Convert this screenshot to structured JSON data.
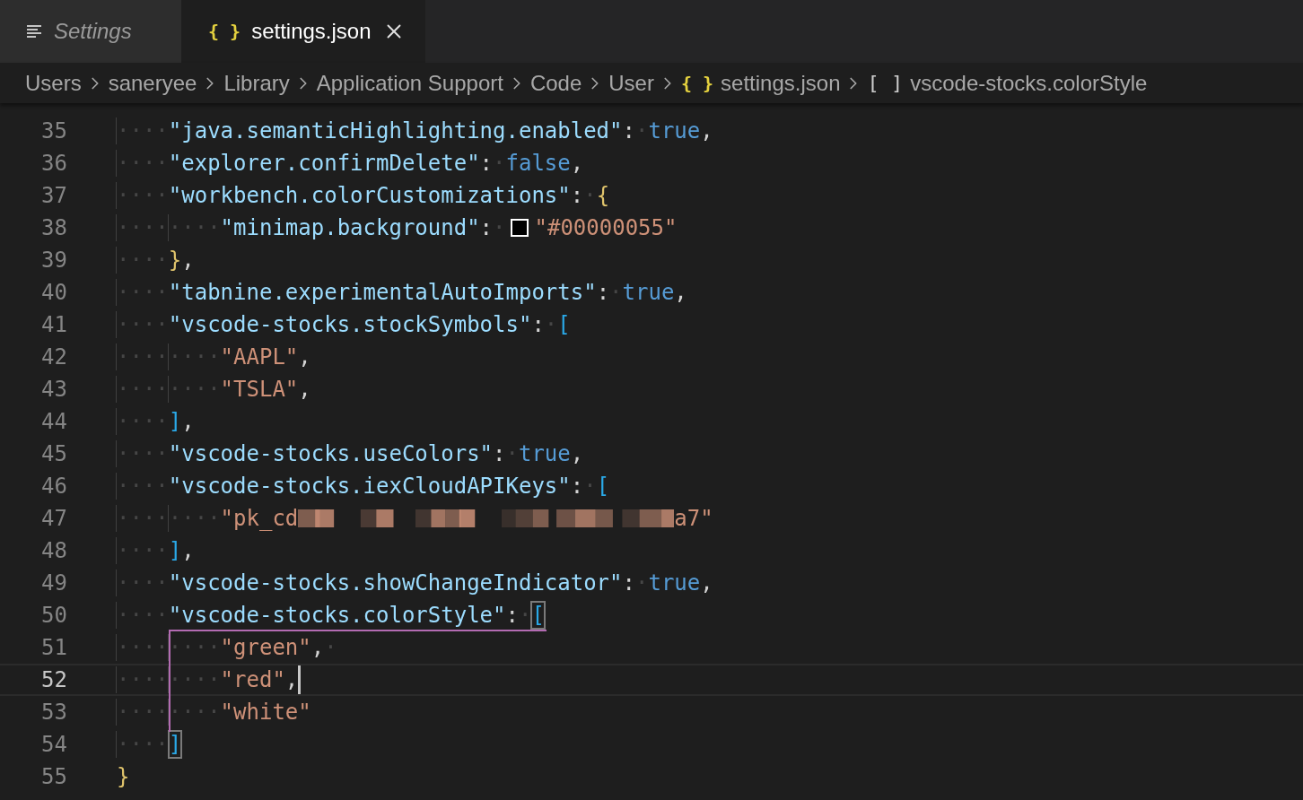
{
  "tabs": [
    {
      "label": "Settings",
      "kind": "settings",
      "selected": false,
      "closable": false
    },
    {
      "label": "settings.json",
      "kind": "file",
      "icon_text": "{ }",
      "selected": true,
      "closable": true
    }
  ],
  "breadcrumb": [
    {
      "label": "Users"
    },
    {
      "label": "saneryee"
    },
    {
      "label": "Library"
    },
    {
      "label": "Application Support"
    },
    {
      "label": "Code"
    },
    {
      "label": "User"
    },
    {
      "label": "settings.json",
      "icon_text": "{ }",
      "kind": "json"
    },
    {
      "label": "vscode-stocks.colorStyle",
      "icon_text": "[ ]",
      "kind": "array"
    }
  ],
  "editor": {
    "lines": [
      {
        "number": "35",
        "current": false,
        "tokens": [
          {
            "kind": "indent",
            "text": "····"
          },
          {
            "kind": "key",
            "text": "\"java.semanticHighlighting.enabled\""
          },
          {
            "kind": "punct",
            "text": ":"
          },
          {
            "kind": "ws",
            "text": "·"
          },
          {
            "kind": "bool",
            "text": "true"
          },
          {
            "kind": "punct",
            "text": ","
          }
        ]
      },
      {
        "number": "36",
        "current": false,
        "tokens": [
          {
            "kind": "indent",
            "text": "····"
          },
          {
            "kind": "key",
            "text": "\"explorer.confirmDelete\""
          },
          {
            "kind": "punct",
            "text": ":"
          },
          {
            "kind": "ws",
            "text": "·"
          },
          {
            "kind": "bool",
            "text": "false"
          },
          {
            "kind": "punct",
            "text": ","
          }
        ]
      },
      {
        "number": "37",
        "current": false,
        "tokens": [
          {
            "kind": "indent",
            "text": "····"
          },
          {
            "kind": "key",
            "text": "\"workbench.colorCustomizations\""
          },
          {
            "kind": "punct",
            "text": ":"
          },
          {
            "kind": "ws",
            "text": "·"
          },
          {
            "kind": "brace",
            "text": "{",
            "matched": false
          }
        ]
      },
      {
        "number": "38",
        "current": false,
        "tokens": [
          {
            "kind": "indent",
            "text": "····"
          },
          {
            "kind": "indent",
            "text": "····"
          },
          {
            "kind": "key",
            "text": "\"minimap.background\""
          },
          {
            "kind": "punct",
            "text": ":"
          },
          {
            "kind": "ws",
            "text": "·"
          },
          {
            "kind": "swatch"
          },
          {
            "kind": "str",
            "text": "\"#00000055\""
          }
        ]
      },
      {
        "number": "39",
        "current": false,
        "tokens": [
          {
            "kind": "indent",
            "text": "····"
          },
          {
            "kind": "brace",
            "text": "}",
            "matched": false
          },
          {
            "kind": "punct",
            "text": ","
          }
        ]
      },
      {
        "number": "40",
        "current": false,
        "tokens": [
          {
            "kind": "indent",
            "text": "····"
          },
          {
            "kind": "key",
            "text": "\"tabnine.experimentalAutoImports\""
          },
          {
            "kind": "punct",
            "text": ":"
          },
          {
            "kind": "ws",
            "text": "·"
          },
          {
            "kind": "bool",
            "text": "true"
          },
          {
            "kind": "punct",
            "text": ","
          }
        ]
      },
      {
        "number": "41",
        "current": false,
        "tokens": [
          {
            "kind": "indent",
            "text": "····"
          },
          {
            "kind": "key",
            "text": "\"vscode-stocks.stockSymbols\""
          },
          {
            "kind": "punct",
            "text": ":"
          },
          {
            "kind": "ws",
            "text": "·"
          },
          {
            "kind": "bracket",
            "text": "[",
            "matched": false
          }
        ]
      },
      {
        "number": "42",
        "current": false,
        "tokens": [
          {
            "kind": "indent",
            "text": "····"
          },
          {
            "kind": "indent",
            "text": "····"
          },
          {
            "kind": "str",
            "text": "\"AAPL\""
          },
          {
            "kind": "punct",
            "text": ","
          }
        ]
      },
      {
        "number": "43",
        "current": false,
        "tokens": [
          {
            "kind": "indent",
            "text": "····"
          },
          {
            "kind": "indent",
            "text": "····"
          },
          {
            "kind": "str",
            "text": "\"TSLA\""
          },
          {
            "kind": "punct",
            "text": ","
          }
        ]
      },
      {
        "number": "44",
        "current": false,
        "tokens": [
          {
            "kind": "indent",
            "text": "····"
          },
          {
            "kind": "bracket",
            "text": "]",
            "matched": false
          },
          {
            "kind": "punct",
            "text": ","
          }
        ]
      },
      {
        "number": "45",
        "current": false,
        "tokens": [
          {
            "kind": "indent",
            "text": "····"
          },
          {
            "kind": "key",
            "text": "\"vscode-stocks.useColors\""
          },
          {
            "kind": "punct",
            "text": ":"
          },
          {
            "kind": "ws",
            "text": "·"
          },
          {
            "kind": "bool",
            "text": "true"
          },
          {
            "kind": "punct",
            "text": ","
          }
        ]
      },
      {
        "number": "46",
        "current": false,
        "tokens": [
          {
            "kind": "indent",
            "text": "····"
          },
          {
            "kind": "key",
            "text": "\"vscode-stocks.iexCloudAPIKeys\""
          },
          {
            "kind": "punct",
            "text": ":"
          },
          {
            "kind": "ws",
            "text": "·"
          },
          {
            "kind": "bracket",
            "text": "[",
            "matched": false
          }
        ]
      },
      {
        "number": "47",
        "current": false,
        "tokens": [
          {
            "kind": "indent",
            "text": "····"
          },
          {
            "kind": "indent",
            "text": "····"
          },
          {
            "kind": "str",
            "text": "\"pk_cd"
          },
          {
            "kind": "redacted"
          },
          {
            "kind": "str",
            "text": "a7\""
          }
        ]
      },
      {
        "number": "48",
        "current": false,
        "tokens": [
          {
            "kind": "indent",
            "text": "····"
          },
          {
            "kind": "bracket",
            "text": "]",
            "matched": false
          },
          {
            "kind": "punct",
            "text": ","
          }
        ]
      },
      {
        "number": "49",
        "current": false,
        "tokens": [
          {
            "kind": "indent",
            "text": "····"
          },
          {
            "kind": "key",
            "text": "\"vscode-stocks.showChangeIndicator\""
          },
          {
            "kind": "punct",
            "text": ":"
          },
          {
            "kind": "ws",
            "text": "·"
          },
          {
            "kind": "bool",
            "text": "true"
          },
          {
            "kind": "punct",
            "text": ","
          }
        ]
      },
      {
        "number": "50",
        "current": false,
        "tokens": [
          {
            "kind": "indent",
            "text": "····"
          },
          {
            "kind": "key",
            "text": "\"vscode-stocks.colorStyle\""
          },
          {
            "kind": "punct",
            "text": ":"
          },
          {
            "kind": "ws",
            "text": "·"
          },
          {
            "kind": "bracket",
            "text": "[",
            "matched": true
          }
        ]
      },
      {
        "number": "51",
        "current": false,
        "tokens": [
          {
            "kind": "indent",
            "text": "····"
          },
          {
            "kind": "indent",
            "text": "····"
          },
          {
            "kind": "str",
            "text": "\"green\""
          },
          {
            "kind": "punct",
            "text": ","
          },
          {
            "kind": "ws",
            "text": "·"
          }
        ]
      },
      {
        "number": "52",
        "current": true,
        "tokens": [
          {
            "kind": "indent",
            "text": "····"
          },
          {
            "kind": "indent",
            "text": "····"
          },
          {
            "kind": "str",
            "text": "\"red\""
          },
          {
            "kind": "punct",
            "text": ","
          },
          {
            "kind": "cursor"
          }
        ]
      },
      {
        "number": "53",
        "current": false,
        "tokens": [
          {
            "kind": "indent",
            "text": "····"
          },
          {
            "kind": "indent",
            "text": "····"
          },
          {
            "kind": "str",
            "text": "\"white\""
          }
        ]
      },
      {
        "number": "54",
        "current": false,
        "tokens": [
          {
            "kind": "indent",
            "text": "····"
          },
          {
            "kind": "bracket",
            "text": "]",
            "matched": true
          }
        ]
      },
      {
        "number": "55",
        "current": false,
        "tokens": [
          {
            "kind": "brace",
            "text": "}",
            "matched": false
          }
        ]
      }
    ]
  }
}
